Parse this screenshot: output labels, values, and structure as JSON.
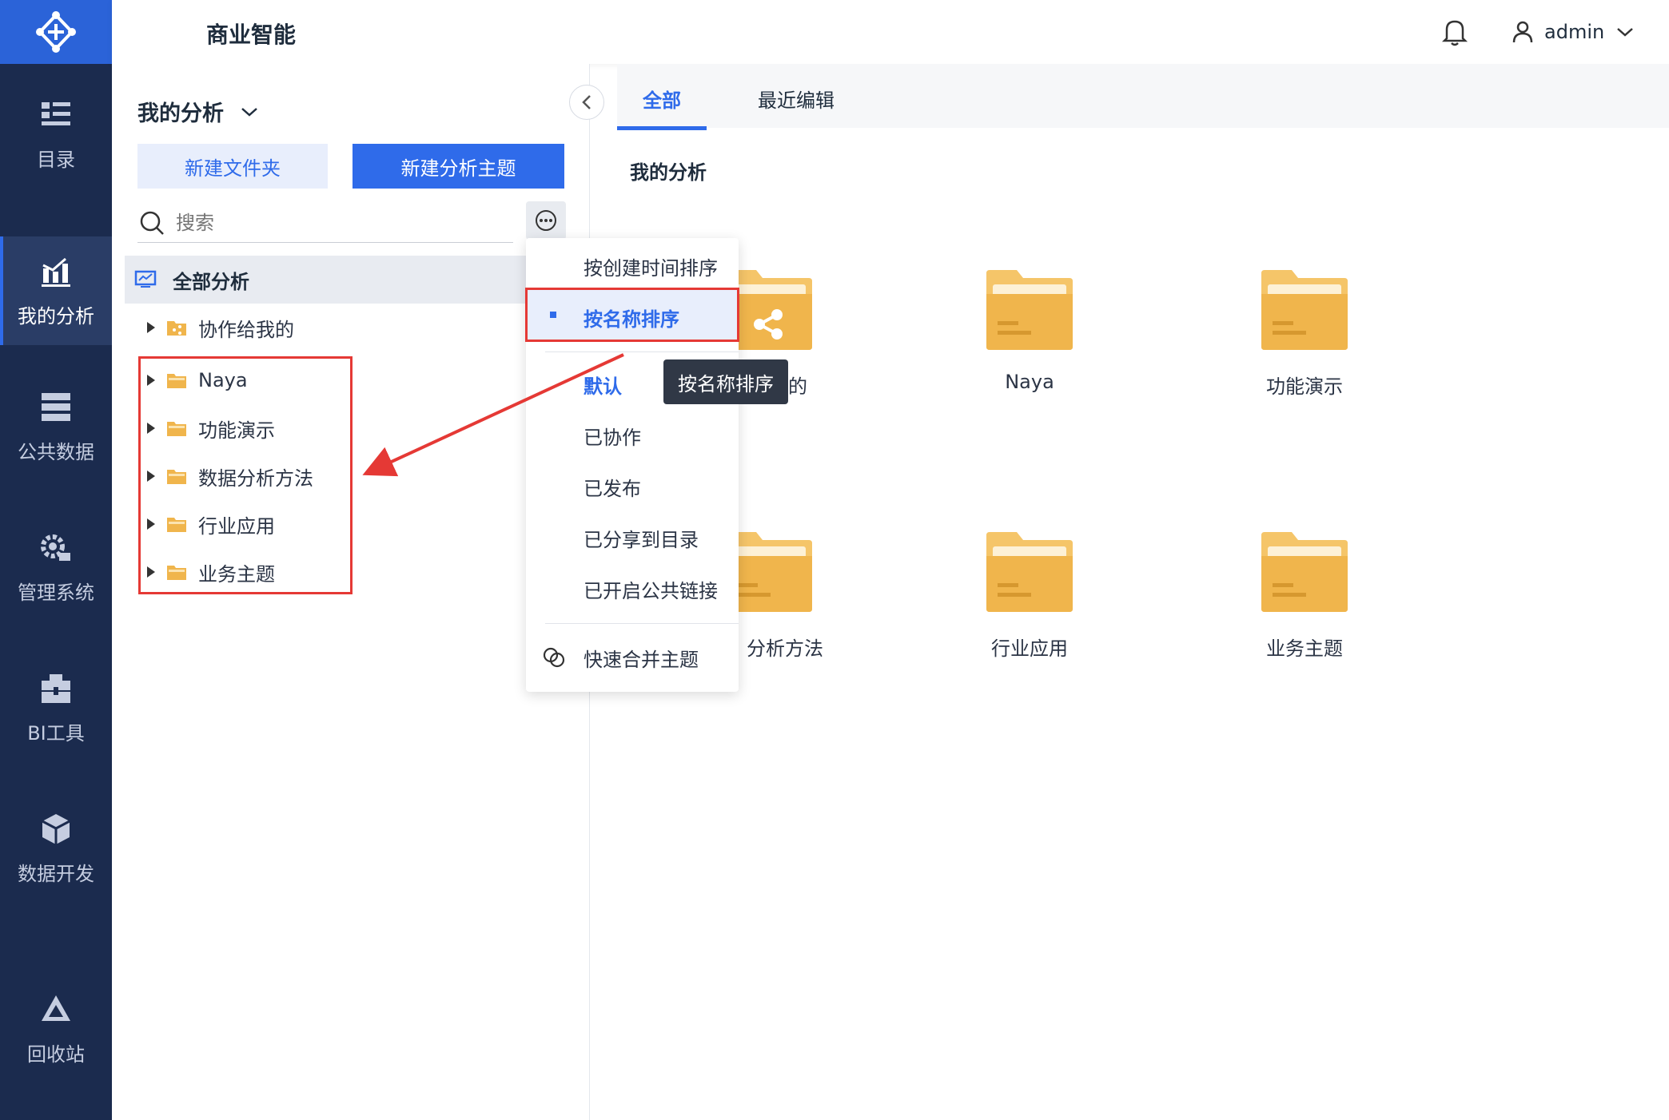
{
  "header": {
    "app_title": "商业智能",
    "username": "admin"
  },
  "nav": {
    "items": [
      {
        "label": "目录",
        "icon": "catalog-icon"
      },
      {
        "label": "我的分析",
        "icon": "analysis-chart-icon",
        "active": true
      },
      {
        "label": "公共数据",
        "icon": "public-data-icon"
      },
      {
        "label": "管理系统",
        "icon": "gear-icon"
      },
      {
        "label": "BI工具",
        "icon": "toolbox-icon"
      },
      {
        "label": "数据开发",
        "icon": "cube-icon"
      },
      {
        "label": "回收站",
        "icon": "recycle-icon"
      }
    ]
  },
  "panel": {
    "title": "我的分析",
    "new_folder": "新建文件夹",
    "new_topic": "新建分析主题",
    "search_placeholder": "搜索",
    "tree_root": "全部分析",
    "tree_items": [
      "协作给我的",
      "Naya",
      "功能演示",
      "数据分析方法",
      "行业应用",
      "业务主题"
    ]
  },
  "tabs": {
    "all": "全部",
    "recent": "最近编辑"
  },
  "content": {
    "title": "我的分析",
    "cards": [
      "协作给我的",
      "Naya",
      "功能演示",
      "数据分析方法",
      "行业应用",
      "业务主题"
    ],
    "visible_labels": [
      "作给我的",
      "Naya",
      "功能演示",
      "分析方法",
      "行业应用",
      "业务主题"
    ]
  },
  "menu": {
    "sort_created": "按创建时间排序",
    "sort_name": "按名称排序",
    "filter_default": "默认",
    "filter_collab": "已协作",
    "filter_published": "已发布",
    "filter_shared_catalog": "已分享到目录",
    "filter_public_link": "已开启公共链接",
    "quick_merge": "快速合并主题"
  },
  "tooltip": "按名称排序",
  "colors": {
    "nav_bg": "#1b2b4e",
    "accent": "#2f6bea",
    "folder": "#f0b54c",
    "highlight_red": "#e53935"
  }
}
